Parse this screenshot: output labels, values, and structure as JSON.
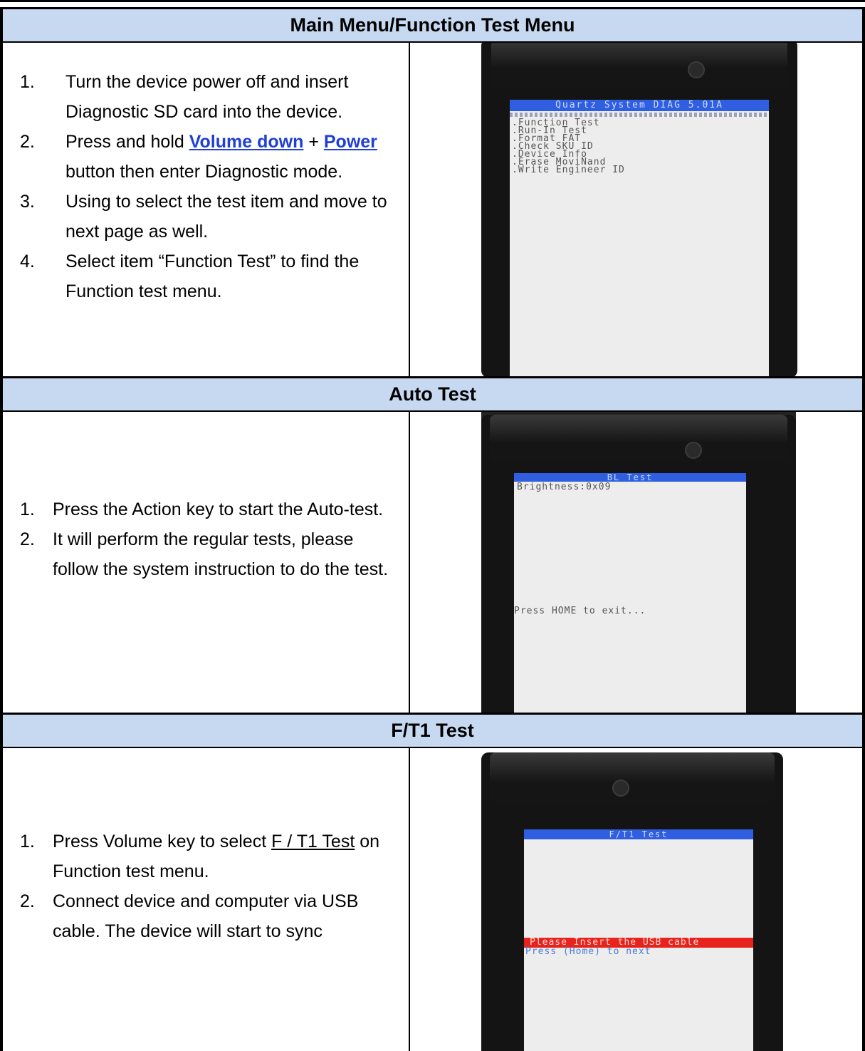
{
  "sections": [
    {
      "title": "Main Menu/Function Test Menu",
      "steps": [
        {
          "num": "1.",
          "text_a": "Turn the device power off and insert Diagnostic SD card into the device."
        },
        {
          "num": "2.",
          "text_a": "Press and hold ",
          "link_1": "Volume down",
          "text_b": " + ",
          "link_2": "Power ",
          "text_c": "button then enter Diagnostic mode."
        },
        {
          "num": "3.",
          "text_a": "Using to select the test item and move to next page as well."
        },
        {
          "num": "4.",
          "text_a": "Select item “Function Test” to find  the Function test menu."
        }
      ],
      "screen": {
        "header": "Quartz System DIAG 5.01A",
        "menu": [
          ".Function Test",
          ".Run-In Test",
          ".Format FAT",
          ".Check SKU ID",
          ".Device Info",
          ".Erase MoviNand",
          ".Write Engineer ID"
        ]
      }
    },
    {
      "title": "Auto Test",
      "steps": [
        {
          "num": "1.",
          "text_a": "Press the Action key to start the Auto-test."
        },
        {
          "num": "2.",
          "text_a": "It will perform the regular tests, please follow the system instruction to do the test."
        }
      ],
      "screen": {
        "header": "BL  Test",
        "line1": "Brightness:0x09",
        "line2": "Press HOME to exit..."
      }
    },
    {
      "title": "F/T1 Test",
      "steps": [
        {
          "num": "1.",
          "text_a": "Press Volume key to select ",
          "underlined": "F / T1 Test",
          "text_b": " on Function test menu."
        },
        {
          "num": "2.",
          "text_a": "Connect device and computer via USB cable. The device will start to sync"
        }
      ],
      "screen": {
        "header": "F/T1 Test",
        "alert": "Please Insert the USB cable",
        "hint": "Press (Home) to next"
      }
    }
  ]
}
